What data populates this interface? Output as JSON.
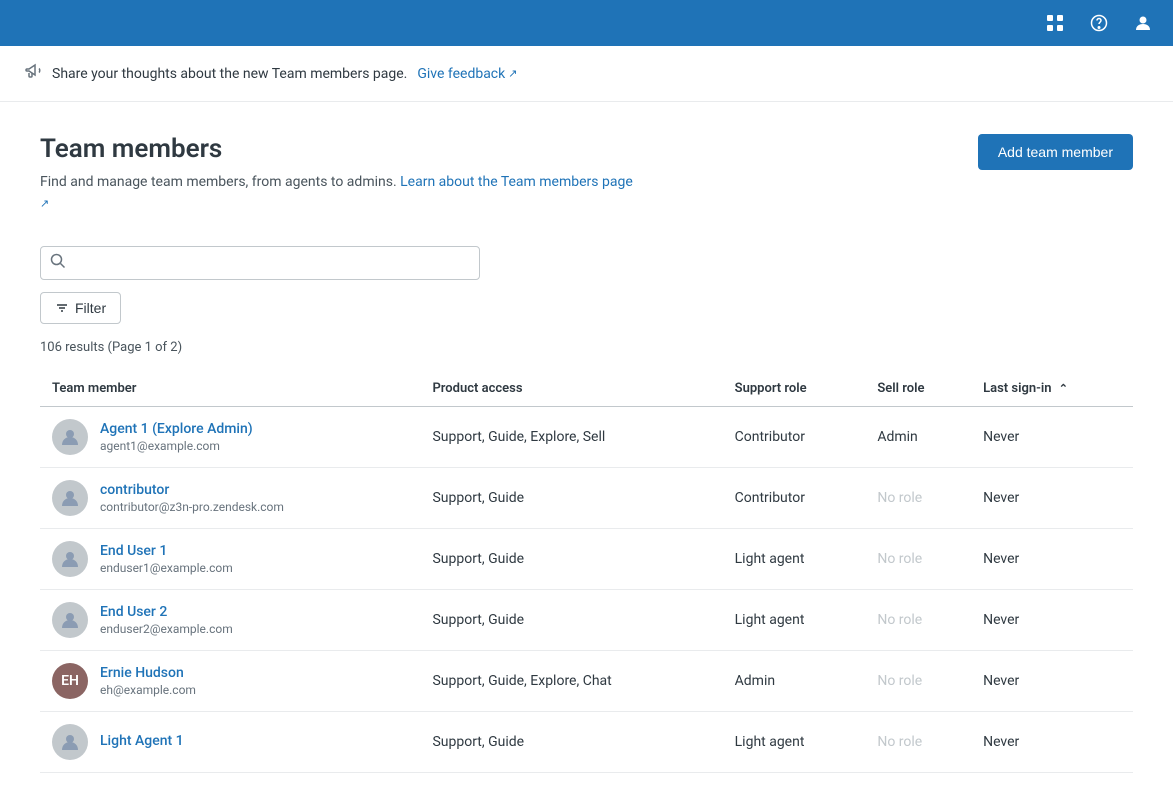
{
  "topNav": {
    "icons": [
      "grid-icon",
      "help-icon",
      "user-icon"
    ]
  },
  "banner": {
    "text": "Share your thoughts about the new Team members page.",
    "linkText": "Give feedback",
    "icon": "megaphone-icon"
  },
  "page": {
    "title": "Team members",
    "subtitle": "Find and manage team members, from agents to admins.",
    "learnLinkText": "Learn about the Team members page",
    "addButtonLabel": "Add team member"
  },
  "search": {
    "placeholder": ""
  },
  "filter": {
    "label": "Filter"
  },
  "results": {
    "text": "106 results (Page 1 of 2)"
  },
  "table": {
    "columns": [
      {
        "key": "member",
        "label": "Team member",
        "sortable": false
      },
      {
        "key": "access",
        "label": "Product access",
        "sortable": false
      },
      {
        "key": "support",
        "label": "Support role",
        "sortable": false
      },
      {
        "key": "sell",
        "label": "Sell role",
        "sortable": false
      },
      {
        "key": "signin",
        "label": "Last sign-in",
        "sortable": true
      }
    ],
    "rows": [
      {
        "name": "Agent 1 (Explore Admin)",
        "email": "agent1@example.com",
        "access": "Support, Guide, Explore, Sell",
        "support": "Contributor",
        "sell": "Admin",
        "signin": "Never",
        "hasAvatar": false
      },
      {
        "name": "contributor",
        "email": "contributor@z3n-pro.zendesk.com",
        "access": "Support, Guide",
        "support": "Contributor",
        "sell": "No role",
        "signin": "Never",
        "hasAvatar": false
      },
      {
        "name": "End User 1",
        "email": "enduser1@example.com",
        "access": "Support, Guide",
        "support": "Light agent",
        "sell": "No role",
        "signin": "Never",
        "hasAvatar": false
      },
      {
        "name": "End User 2",
        "email": "enduser2@example.com",
        "access": "Support, Guide",
        "support": "Light agent",
        "sell": "No role",
        "signin": "Never",
        "hasAvatar": false
      },
      {
        "name": "Ernie Hudson",
        "email": "eh@example.com",
        "access": "Support, Guide, Explore, Chat",
        "support": "Admin",
        "sell": "No role",
        "signin": "Never",
        "hasAvatar": true,
        "avatarColor": "#8B6563"
      },
      {
        "name": "Light Agent 1",
        "email": "",
        "access": "Support, Guide",
        "support": "Light agent",
        "sell": "No role",
        "signin": "Never",
        "hasAvatar": false
      }
    ]
  }
}
